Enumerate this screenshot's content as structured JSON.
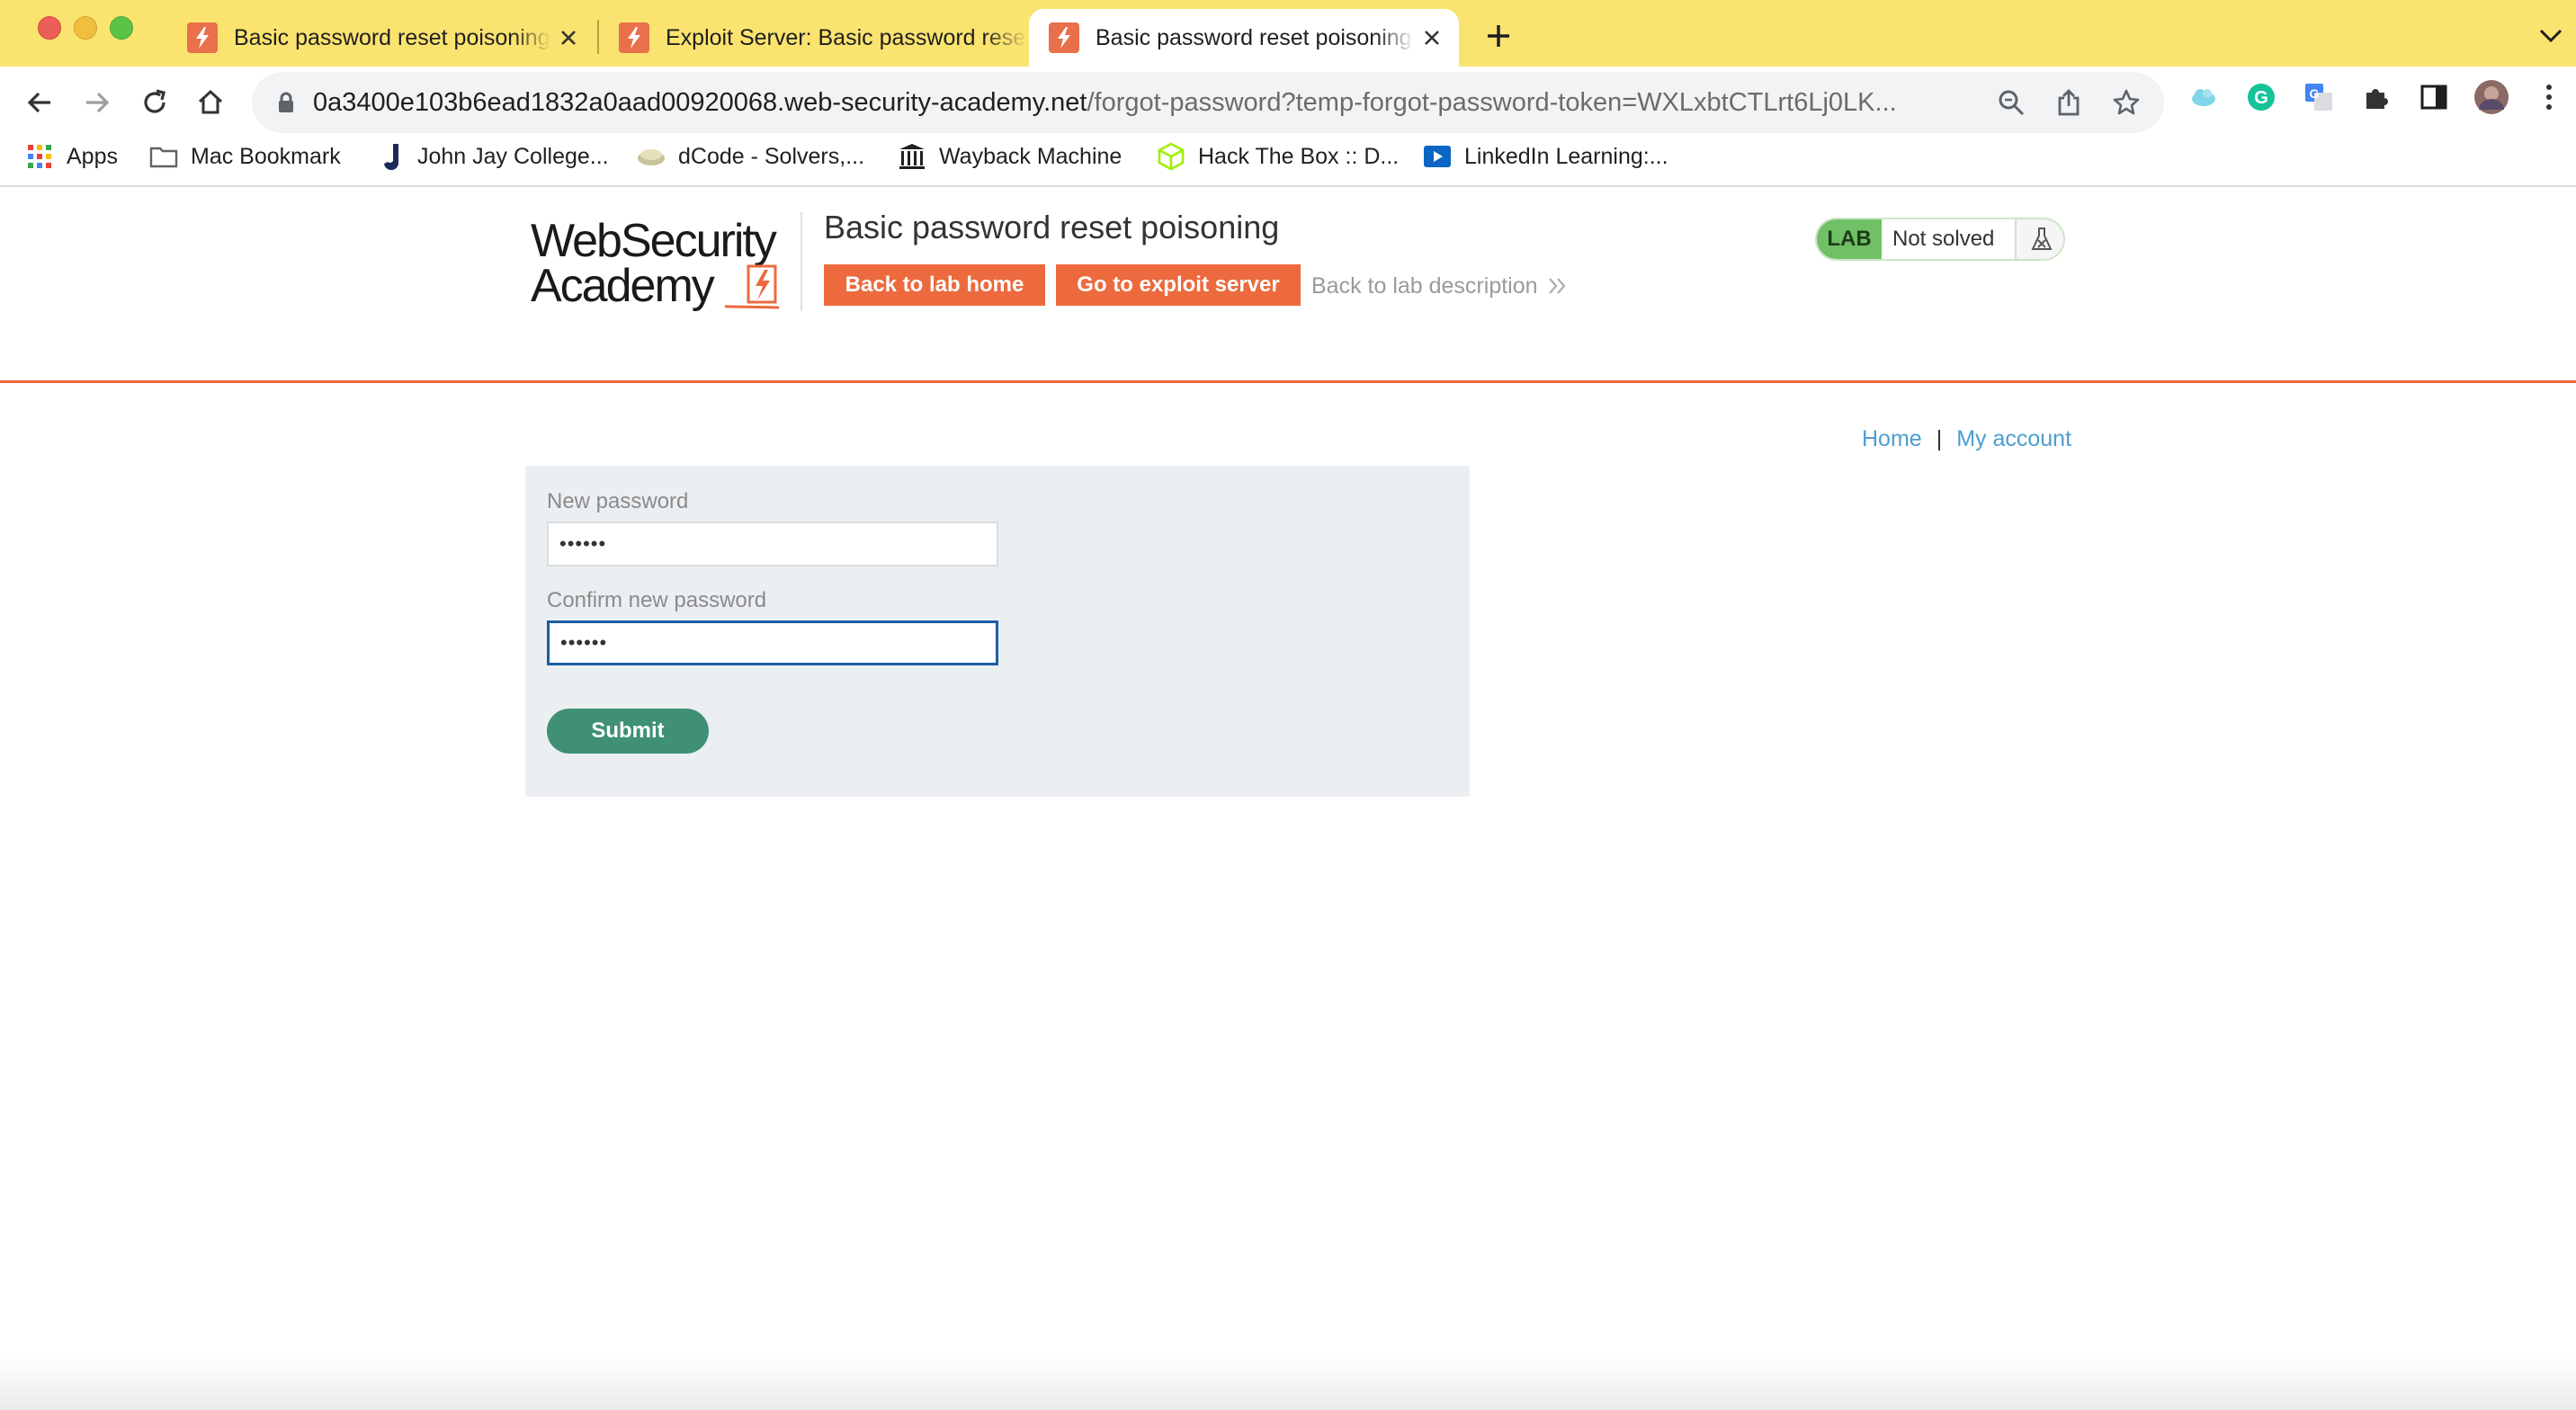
{
  "browser": {
    "tabs": [
      {
        "title": "Basic password reset poisoning",
        "active": false
      },
      {
        "title": "Exploit Server: Basic password reset poisoning",
        "active": false
      },
      {
        "title": "Basic password reset poisoning",
        "active": true
      }
    ],
    "url_host": "0a3400e103b6ead1832a0aad00920068.web-security-academy.net",
    "url_path": "/forgot-password?temp-forgot-password-token=WXLxbtCTLrt6Lj0LK...",
    "bookmarks": [
      {
        "label": "Apps",
        "icon": "apps-grid-icon"
      },
      {
        "label": "Mac Bookmark",
        "icon": "folder-icon"
      },
      {
        "label": "John Jay College...",
        "icon": "john-jay-icon"
      },
      {
        "label": "dCode - Solvers,...",
        "icon": "dcode-icon"
      },
      {
        "label": "Wayback Machine",
        "icon": "wayback-icon"
      },
      {
        "label": "Hack The Box :: D...",
        "icon": "hackthebox-icon"
      },
      {
        "label": "LinkedIn Learning:...",
        "icon": "linkedin-learning-icon"
      }
    ]
  },
  "lab": {
    "logo_line1": "WebSecurity",
    "logo_line2": "Academy",
    "title": "Basic password reset poisoning",
    "back_to_lab_home": "Back to lab home",
    "go_to_exploit_server": "Go to exploit server",
    "back_to_lab_description": "Back to lab description",
    "badge": "LAB",
    "status": "Not solved"
  },
  "nav": {
    "home": "Home",
    "separator": "|",
    "my_account": "My account"
  },
  "form": {
    "new_password_label": "New password",
    "new_password_value": "••••••",
    "confirm_password_label": "Confirm new password",
    "confirm_password_value": "••••••",
    "submit": "Submit"
  },
  "colors": {
    "tab_strip": "#fbe36f",
    "accent_orange": "#ec6a3e",
    "submit_green": "#3f9074",
    "lab_badge_green": "#70c065",
    "link_blue": "#4d9dd0"
  }
}
